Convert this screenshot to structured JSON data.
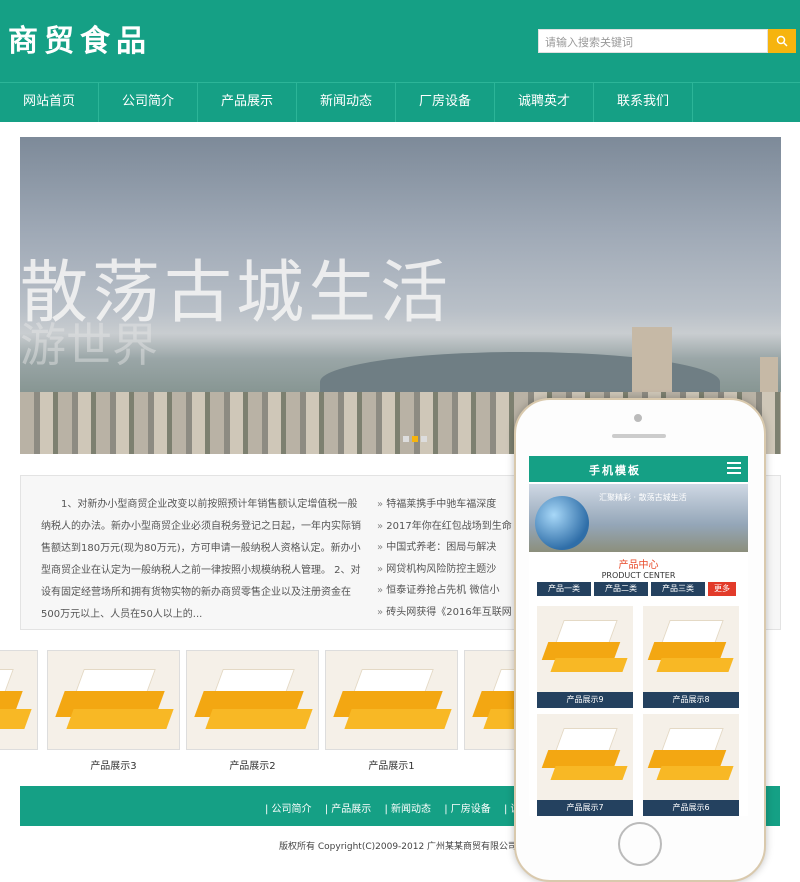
{
  "site": {
    "logo": "商贸食品"
  },
  "search": {
    "placeholder": "请输入搜索关键词"
  },
  "nav": [
    "网站首页",
    "公司简介",
    "产品展示",
    "新闻动态",
    "厂房设备",
    "诚聘英才",
    "联系我们"
  ],
  "banner": {
    "headline": "散荡古城生活",
    "ghost": "游世界"
  },
  "intro": "1、对新办小型商贸企业改变以前按照预计年销售额认定增值税一般纳税人的办法。新办小型商贸企业必须自税务登记之日起，一年内实际销售额达到180万元(现为80万元)，方可申请一般纳税人资格认定。新办小型商贸企业在认定为一般纳税人之前一律按照小规模纳税人管理。 2、对设有固定经营场所和拥有货物实物的新办商贸零售企业以及注册资金在500万元以上、人员在50人以上的...",
  "news": [
    "特福莱携手中驰车福深度",
    "2017年你在红包战场到生命",
    "中国式养老：困局与解决",
    "网贷机构风险防控主题沙",
    "恒泰证券抢占先机 微信小",
    "砖头网获得《2016年互联网"
  ],
  "products": [
    {
      "label": "产品展示3"
    },
    {
      "label": "产品展示2"
    },
    {
      "label": "产品展示1"
    },
    {
      "label": "产"
    }
  ],
  "footer": {
    "links": [
      "| 公司简介",
      "| 产品展示",
      "| 新闻动态",
      "| 厂房设备",
      "| 诚聘"
    ],
    "copyright": "版权所有 Copyright(C)2009-2012 广州某某商贸有限公司"
  },
  "mobile": {
    "title": "手机模板",
    "banner_text": "汇聚精彩 · 散荡古城生活",
    "section_cn": "产品中心",
    "section_en": "PRODUCT CENTER",
    "tabs": [
      "产品一类",
      "产品二类",
      "产品三类",
      "更多"
    ],
    "products": [
      "产品展示9",
      "产品展示8",
      "产品展示7",
      "产品展示6"
    ]
  }
}
